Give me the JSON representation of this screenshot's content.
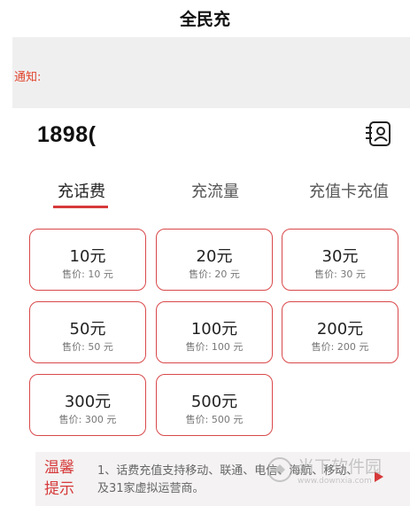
{
  "header": {
    "title": "全民充"
  },
  "notice": {
    "label": "通知:"
  },
  "phone": {
    "value": "1898("
  },
  "tabs": [
    {
      "label": "充话费",
      "active": true
    },
    {
      "label": "充流量",
      "active": false
    },
    {
      "label": "充值卡充值",
      "active": false
    }
  ],
  "options": [
    {
      "amount": "10元",
      "price": "售价: 10 元"
    },
    {
      "amount": "20元",
      "price": "售价: 20 元"
    },
    {
      "amount": "30元",
      "price": "售价: 30 元"
    },
    {
      "amount": "50元",
      "price": "售价: 50 元"
    },
    {
      "amount": "100元",
      "price": "售价: 100 元"
    },
    {
      "amount": "200元",
      "price": "售价: 200 元"
    },
    {
      "amount": "300元",
      "price": "售价: 300 元"
    },
    {
      "amount": "500元",
      "price": "售价: 500 元"
    }
  ],
  "tips": {
    "heading": "温馨提示",
    "text": "1、话费充值支持移动、联通、电信、海航、移动、及31家虚拟运营商。"
  },
  "watermark": {
    "name": "当下软件园",
    "url": "www.downxia.com"
  },
  "colors": {
    "accent": "#d6393a",
    "notice_text": "#e0442c",
    "notice_bg": "#f0eff0"
  },
  "icons": {
    "contact": "contact-book-icon",
    "tips_arrow": "arrow-right-icon"
  }
}
